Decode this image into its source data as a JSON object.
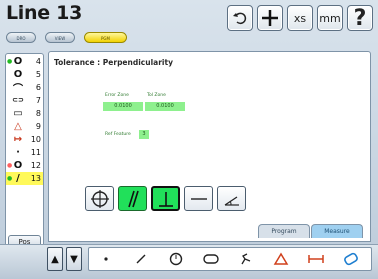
{
  "header": {
    "title": "Line 13",
    "modes": [
      {
        "label": "DRO",
        "active": false
      },
      {
        "label": "VIEW",
        "active": false
      },
      {
        "label": "PGM",
        "active": true
      }
    ],
    "toolbar": {
      "undo_icon": "undo-icon",
      "add_icon": "crosshair-icon",
      "units_xs": "xs",
      "units_mm": "mm",
      "help": "?"
    }
  },
  "sidebar": {
    "features": [
      {
        "icon": "circle-icon",
        "glyph": "O",
        "number": "4",
        "marker": true,
        "selected": false
      },
      {
        "icon": "circle-icon",
        "glyph": "O",
        "number": "5",
        "marker": false,
        "selected": false
      },
      {
        "icon": "arc-icon",
        "glyph": "⌒",
        "number": "6",
        "marker": false,
        "selected": false
      },
      {
        "icon": "slot-icon",
        "glyph": "⊂⊃",
        "number": "7",
        "marker": false,
        "selected": false
      },
      {
        "icon": "rectangle-icon",
        "glyph": "▭",
        "number": "8",
        "marker": false,
        "selected": false
      },
      {
        "icon": "angle-icon",
        "glyph": "△",
        "number": "9",
        "marker": false,
        "selected": false
      },
      {
        "icon": "distance-icon",
        "glyph": "↦",
        "number": "10",
        "marker": false,
        "selected": false
      },
      {
        "icon": "point-icon",
        "glyph": "·",
        "number": "11",
        "marker": false,
        "selected": false
      },
      {
        "icon": "circle-icon",
        "glyph": "O",
        "number": "12",
        "marker": true,
        "selected": false
      },
      {
        "icon": "line-icon",
        "glyph": "/",
        "number": "13",
        "marker": true,
        "selected": true
      }
    ],
    "pos_label": "Pos"
  },
  "panel": {
    "title": "Tolerance : Perpendicularity",
    "error_zone_label": "Error Zone",
    "tol_zone_label": "Tol Zone",
    "error_zone_value": "0.0100",
    "tol_zone_value": "0.0100",
    "ref_feature_label": "Ref Feature",
    "ref_feature_value": "3",
    "tools": [
      {
        "icon": "position-icon",
        "active": false
      },
      {
        "icon": "parallelism-icon",
        "active": true
      },
      {
        "icon": "perpendicularity-icon",
        "active": true
      },
      {
        "icon": "straightness-icon",
        "active": false
      },
      {
        "icon": "angularity-icon",
        "active": false
      }
    ]
  },
  "tabs": {
    "program": "Program",
    "measure": "Measure"
  },
  "measure_bar": [
    {
      "icon": "point-icon"
    },
    {
      "icon": "line-icon"
    },
    {
      "icon": "circle-icon"
    },
    {
      "icon": "slot-icon"
    },
    {
      "icon": "blob-icon"
    },
    {
      "icon": "angle-icon"
    },
    {
      "icon": "distance-icon"
    },
    {
      "icon": "skew-icon"
    }
  ]
}
